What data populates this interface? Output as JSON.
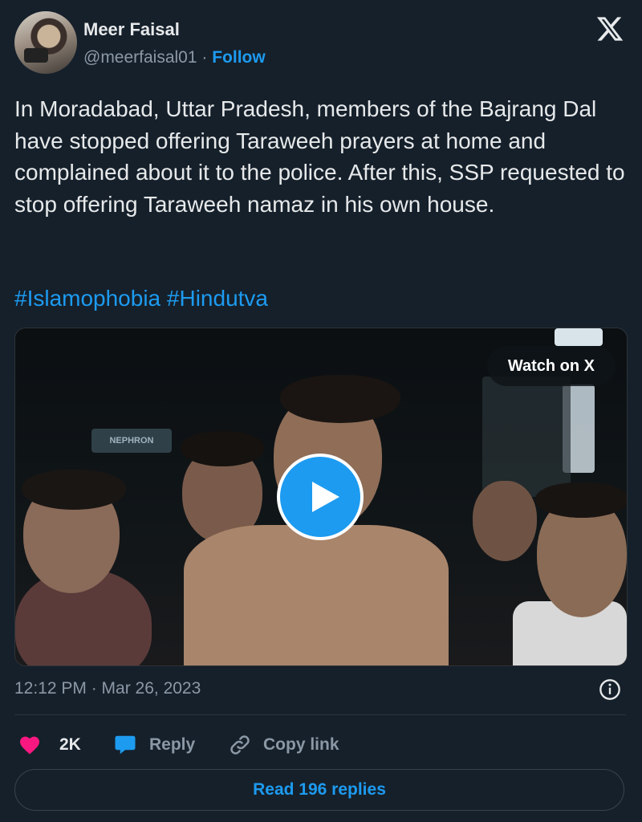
{
  "author": {
    "name": "Meer Faisal",
    "handle": "@meerfaisal01",
    "separator": "·",
    "follow_label": "Follow"
  },
  "tweet": {
    "text": "In Moradabad, Uttar Pradesh, members of the Bajrang Dal have stopped offering Taraweeh prayers at home and complained about it to the police. After this, SSP requested to stop offering Taraweeh namaz in his own house.",
    "hashtags": [
      "#Islamophobia",
      "#Hindutva"
    ],
    "timestamp": "12:12 PM · Mar 26, 2023"
  },
  "media": {
    "watch_label": "Watch on X",
    "sign_text": "NEPHRON"
  },
  "actions": {
    "like_count": "2K",
    "reply_label": "Reply",
    "copy_link_label": "Copy link"
  },
  "replies": {
    "read_label": "Read 196 replies"
  },
  "icons": {
    "logo": "x-logo-icon",
    "like": "heart-icon",
    "reply": "speech-bubble-icon",
    "copy": "link-icon",
    "info": "info-icon",
    "play": "play-icon"
  },
  "colors": {
    "background": "#15202b",
    "accent": "#1d9bf0",
    "like": "#f91880",
    "text": "#e7e9ea",
    "muted": "#8b98a5"
  }
}
